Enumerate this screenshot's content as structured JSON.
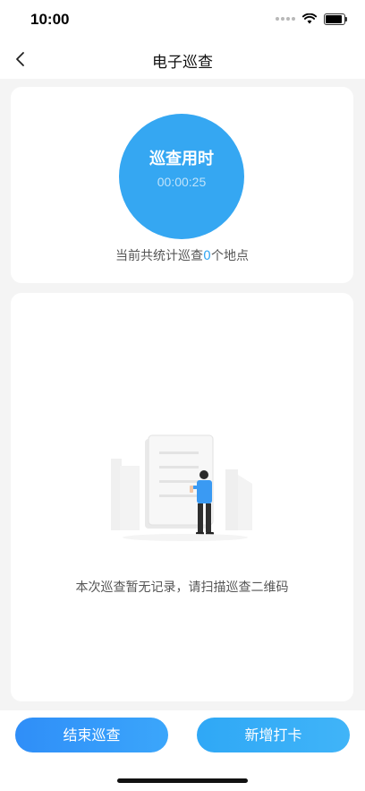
{
  "status_bar": {
    "time": "10:00",
    "icons": [
      "signal-dots-icon",
      "wifi-icon",
      "battery-icon"
    ]
  },
  "nav": {
    "back_icon": "chevron-left-icon",
    "title": "电子巡查"
  },
  "timer_card": {
    "label": "巡查用时",
    "elapsed": "00:00:25",
    "count_prefix": "当前共统计巡查",
    "count_value": "0",
    "count_suffix": "个地点",
    "accent_color": "#35a7f2"
  },
  "records_card": {
    "empty_message": "本次巡查暂无记录，请扫描巡查二维码"
  },
  "actions": {
    "end_label": "结束巡查",
    "add_label": "新增打卡"
  }
}
